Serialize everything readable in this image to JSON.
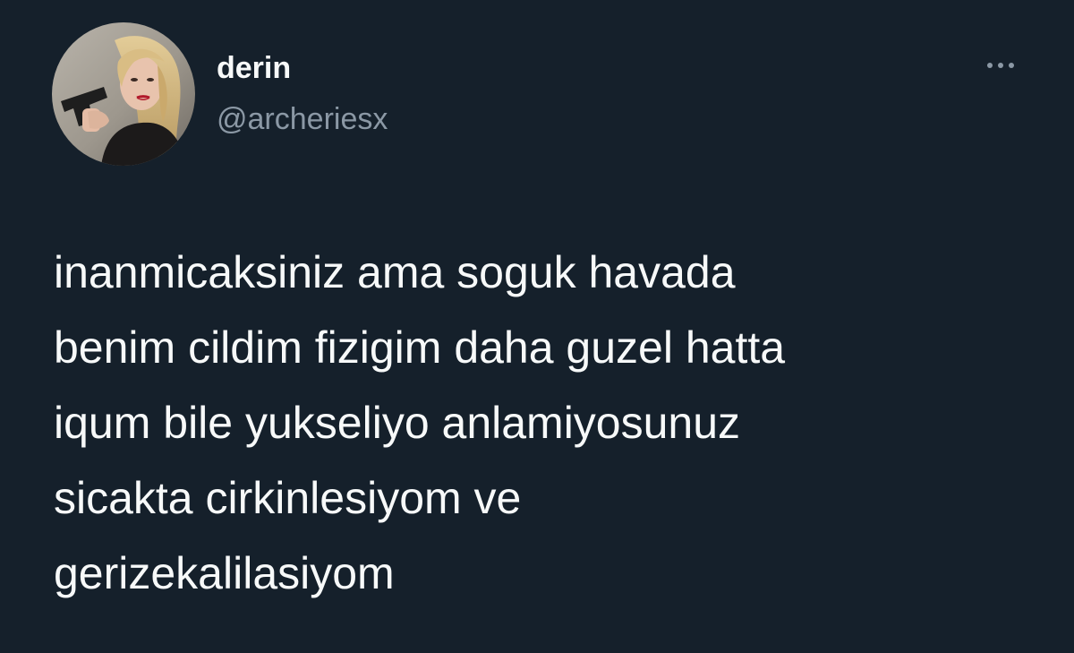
{
  "tweet": {
    "author": {
      "display_name": "derin",
      "handle": "@archeriesx",
      "avatar_icon": "profile-photo"
    },
    "more_icon": "more-horizontal-icon",
    "text_lines": [
      "inanmicaksiniz ama soguk havada",
      "benim cildim fizigim daha guzel hatta",
      "iqum bile yukseliyo anlamiyosunuz",
      "sicakta cirkinlesiyom ve",
      "gerizekalilasiyom"
    ]
  },
  "colors": {
    "background": "#15202b",
    "text_primary": "#f7f9f9",
    "text_secondary": "#8b98a5"
  }
}
